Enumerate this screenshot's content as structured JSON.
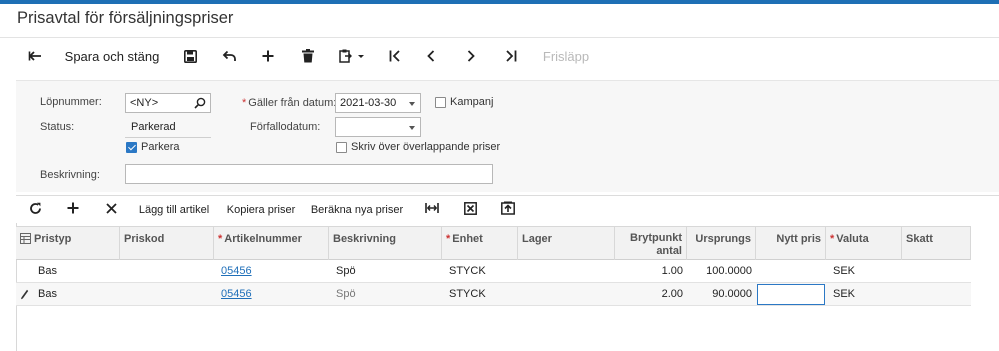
{
  "page": {
    "title": "Prisavtal för försäljningspriser",
    "accent": "#1e6fb5"
  },
  "toolbar": {
    "back_icon": "arrow-left-icon",
    "save_close_label": "Spara och stäng",
    "save_icon": "save-icon",
    "undo_icon": "undo-icon",
    "add_icon": "plus-icon",
    "delete_icon": "trash-icon",
    "copy_paste_icon": "clipboard-dropdown-icon",
    "first_icon": "first-record-icon",
    "prev_icon": "chevron-left-icon",
    "next_icon": "chevron-right-icon",
    "last_icon": "last-record-icon",
    "release_label": "Frisläpp"
  },
  "form": {
    "lopnummer_label": "Löpnummer:",
    "lopnummer_value": "<NY>",
    "status_label": "Status:",
    "status_value": "Parkerad",
    "parkera_label": "Parkera",
    "parkera_checked": true,
    "galler_label": "Gäller från datum:",
    "galler_value": "2021-03-30",
    "forfallo_label": "Förfallodatum:",
    "forfallo_value": "",
    "kampanj_label": "Kampanj",
    "kampanj_checked": false,
    "skriv_label": "Skriv över överlappande priser",
    "skriv_checked": false,
    "beskrivning_label": "Beskrivning:",
    "beskrivning_value": ""
  },
  "gridbar": {
    "refresh_icon": "refresh-icon",
    "add_icon": "plus-icon",
    "remove_icon": "close-icon",
    "add_article_label": "Lägg till artikel",
    "copy_prices_label": "Kopiera priser",
    "calc_prices_label": "Beräkna nya priser",
    "fit_columns_icon": "fit-columns-icon",
    "export_excel_icon": "excel-export-icon",
    "upload_icon": "upload-icon"
  },
  "grid": {
    "columns": [
      "Pristyp",
      "Priskod",
      "Artikelnummer",
      "Beskrivning",
      "Enhet",
      "Lager",
      "Brytpunkt antal",
      "Ursprungs",
      "Nytt pris",
      "Valuta",
      "Skatt"
    ],
    "brytpunkt_line1": "Brytpunkt",
    "brytpunkt_line2": "antal",
    "rows": [
      {
        "pristyp": "Bas",
        "priskod": "",
        "artikelnummer": "05456",
        "beskrivning": "Spö",
        "enhet": "STYCK",
        "lager": "",
        "brytpunkt": "1.00",
        "ursprungs": "100.0000",
        "nytt_pris": "",
        "valuta": "SEK",
        "skatt": ""
      },
      {
        "pristyp": "Bas",
        "priskod": "",
        "artikelnummer": "05456",
        "beskrivning": "Spö",
        "enhet": "STYCK",
        "lager": "",
        "brytpunkt": "2.00",
        "ursprungs": "90.0000",
        "nytt_pris": "",
        "valuta": "SEK",
        "skatt": ""
      }
    ]
  }
}
